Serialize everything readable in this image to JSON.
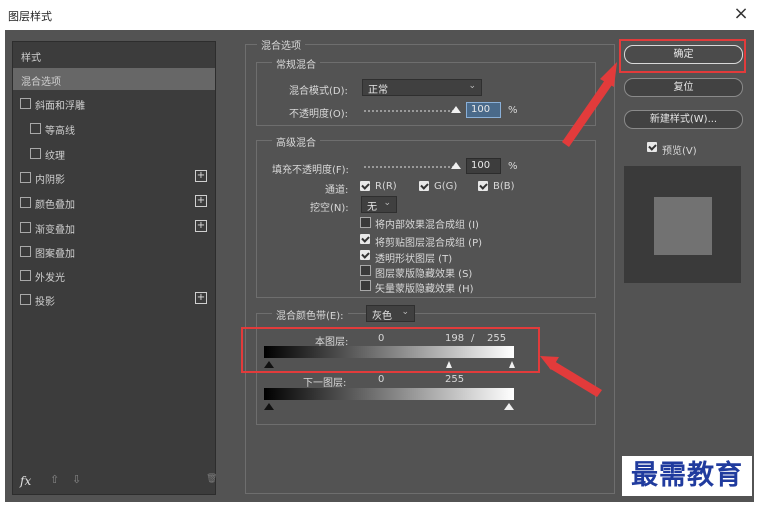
{
  "window": {
    "title": "图层样式",
    "close_glyph": "×"
  },
  "sidebar": {
    "header": "样式",
    "items": [
      {
        "label": "混合选项",
        "selected": true,
        "checkbox": false,
        "plus": false
      },
      {
        "label": "斜面和浮雕",
        "checkbox": true,
        "plus": false
      },
      {
        "label": "等高线",
        "checkbox": true,
        "plus": false,
        "indent": true
      },
      {
        "label": "纹理",
        "checkbox": true,
        "plus": false,
        "indent": true
      },
      {
        "label": "内阴影",
        "checkbox": true,
        "plus": true
      },
      {
        "label": "颜色叠加",
        "checkbox": true,
        "plus": true
      },
      {
        "label": "渐变叠加",
        "checkbox": true,
        "plus": true
      },
      {
        "label": "图案叠加",
        "checkbox": true,
        "plus": false
      },
      {
        "label": "外发光",
        "checkbox": true,
        "plus": false
      },
      {
        "label": "投影",
        "checkbox": true,
        "plus": true
      }
    ],
    "plus_glyph": "+",
    "footer": {
      "fx": "fx",
      "up": "⇧",
      "down": "⇩",
      "trash": "🗑"
    }
  },
  "blend_options": {
    "title": "混合选项",
    "general": {
      "title": "常规混合",
      "mode_label": "混合模式(D):",
      "mode_value": "正常",
      "opacity_label": "不透明度(O):",
      "opacity_value": "100",
      "percent": "%"
    },
    "advanced": {
      "title": "高级混合",
      "fill_label": "填充不透明度(F):",
      "fill_value": "100",
      "percent": "%",
      "channels_label": "通道:",
      "channels": [
        "R(R)",
        "G(G)",
        "B(B)"
      ],
      "knockout_label": "挖空(N):",
      "knockout_value": "无",
      "options": [
        {
          "label": "将内部效果混合成组 (I)",
          "checked": false
        },
        {
          "label": "将剪贴图层混合成组 (P)",
          "checked": true
        },
        {
          "label": "透明形状图层 (T)",
          "checked": true
        },
        {
          "label": "图层蒙版隐藏效果 (S)",
          "checked": false
        },
        {
          "label": "矢量蒙版隐藏效果 (H)",
          "checked": false
        }
      ]
    },
    "blend_if": {
      "label": "混合颜色带(E):",
      "value": "灰色",
      "this_layer": {
        "label": "本图层:",
        "low": "0",
        "high_split": "198",
        "slash": "/",
        "high": "255"
      },
      "underlying": {
        "label": "下一图层:",
        "low": "0",
        "high": "255"
      }
    }
  },
  "buttons": {
    "ok": "确定",
    "reset": "复位",
    "new_style": "新建样式(W)...",
    "preview_label": "预览(V)",
    "preview_checked": true
  },
  "watermark": "最需教育",
  "colors": {
    "dialog_bg": "#535353",
    "annotation_red": "#e23b3b",
    "watermark_blue": "#203b9e"
  }
}
